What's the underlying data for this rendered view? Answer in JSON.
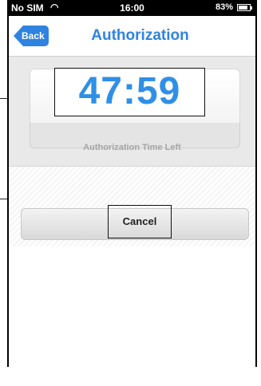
{
  "status_bar": {
    "carrier": "No SIM",
    "wifi_icon": "wifi-icon",
    "time": "16:00",
    "battery_percent": "83%",
    "battery_level": 0.83
  },
  "nav": {
    "back_label": "Back",
    "title": "Authorization"
  },
  "timer": {
    "value": "47:59",
    "caption": "Authorization Time Left"
  },
  "actions": {
    "cancel_label": "Cancel"
  },
  "colors": {
    "accent": "#2f83e0",
    "timer": "#2f8fe6"
  }
}
